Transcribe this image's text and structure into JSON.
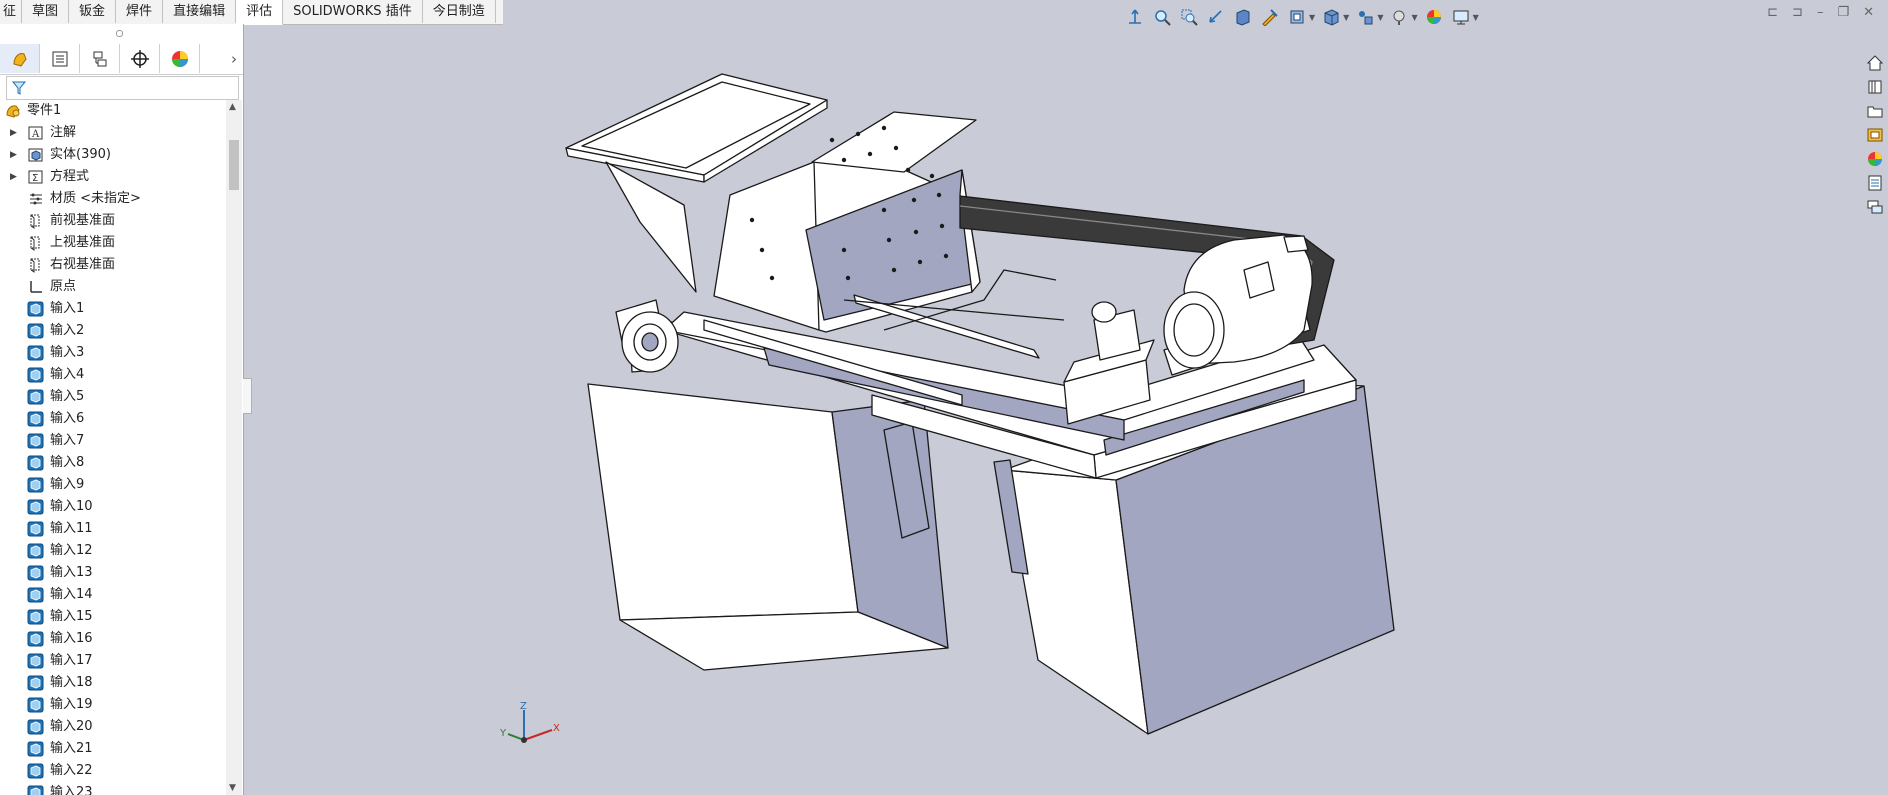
{
  "tabs": [
    "征",
    "草图",
    "钣金",
    "焊件",
    "直接编辑",
    "评估",
    "SOLIDWORKS 插件",
    "今日制造"
  ],
  "active_tab": "评估",
  "panel_tabs": [
    "featuremanager-icon",
    "propertymanager-icon",
    "configuration-icon",
    "dimxpert-icon",
    "display-manager-icon"
  ],
  "tree": {
    "root": "零件1",
    "folders": [
      {
        "label": "注解",
        "icon": "annotation-icon"
      },
      {
        "label": "实体(390)",
        "icon": "solid-bodies-icon"
      },
      {
        "label": "方程式",
        "icon": "equations-icon"
      }
    ],
    "material": "材质 <未指定>",
    "planes": [
      "前视基准面",
      "上视基准面",
      "右视基准面"
    ],
    "origin": "原点",
    "imports": [
      "输入1",
      "输入2",
      "输入3",
      "输入4",
      "输入5",
      "输入6",
      "输入7",
      "输入8",
      "输入9",
      "输入10",
      "输入11",
      "输入12",
      "输入13",
      "输入14",
      "输入15",
      "输入16",
      "输入17",
      "输入18",
      "输入19",
      "输入20",
      "输入21",
      "输入22",
      "输入23"
    ]
  },
  "triad": {
    "x": "X",
    "y": "Y",
    "z": "Z"
  },
  "colors": {
    "viewport_bg": "#c9ccd6",
    "model_face_light": "#ffffff",
    "model_face_shade": "#a3a6c0",
    "edge": "#1a1a1a"
  }
}
